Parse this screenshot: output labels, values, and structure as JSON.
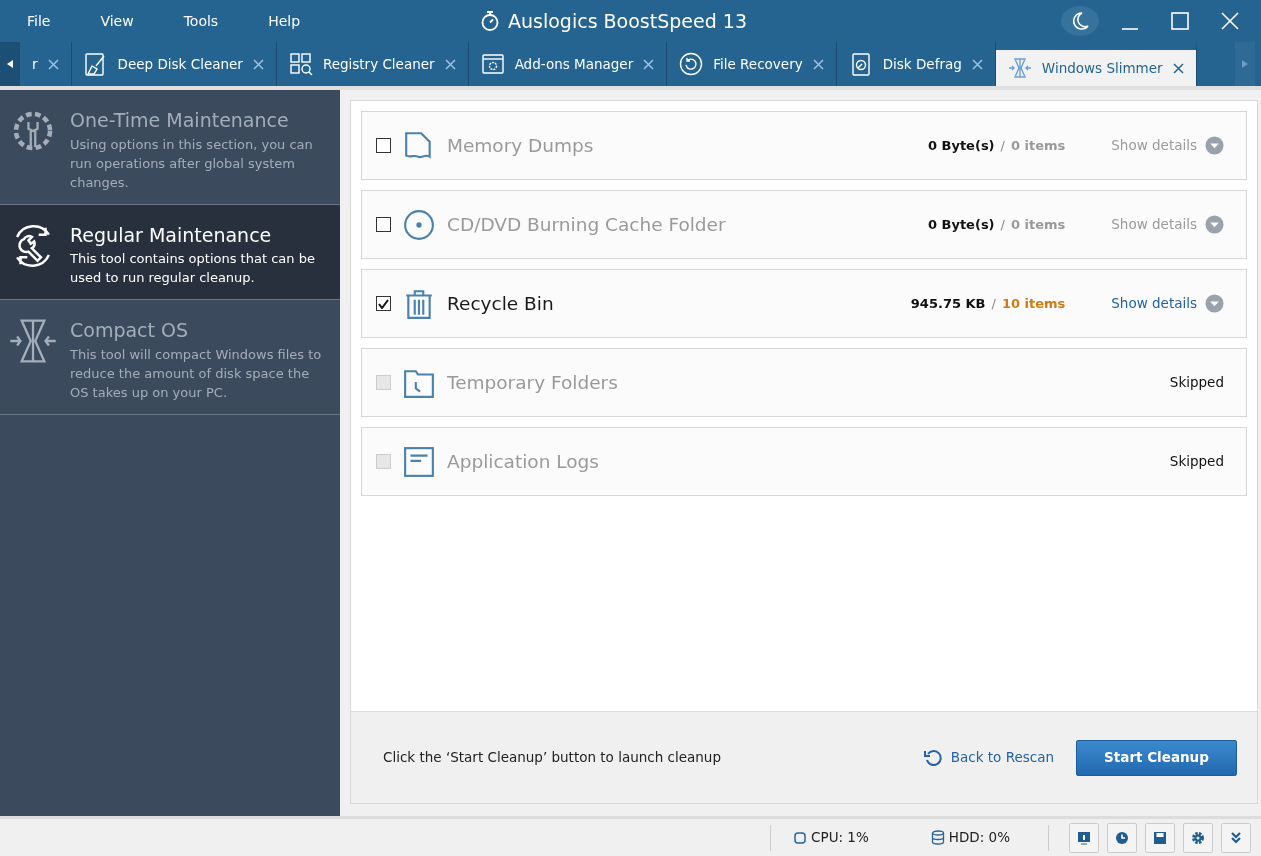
{
  "menu": [
    "File",
    "View",
    "Tools",
    "Help"
  ],
  "window": {
    "title": "Auslogics BoostSpeed 13"
  },
  "tabs": [
    {
      "label": "r",
      "selected": false
    },
    {
      "label": "Deep Disk Cleaner",
      "selected": false
    },
    {
      "label": "Registry Cleaner",
      "selected": false
    },
    {
      "label": "Add-ons Manager",
      "selected": false
    },
    {
      "label": "File Recovery",
      "selected": false
    },
    {
      "label": "Disk Defrag",
      "selected": false
    },
    {
      "label": "Windows Slimmer",
      "selected": true
    }
  ],
  "sidebar": {
    "items": [
      {
        "title": "One-Time Maintenance",
        "description": "Using options in this section, you can run operations after global system changes.",
        "selected": false
      },
      {
        "title": "Regular Maintenance",
        "description": "This tool contains options that can be used to run regular cleanup.",
        "selected": true
      },
      {
        "title": "Compact OS",
        "description": "This tool will compact Windows files to reduce the amount of disk space the OS takes up on your PC.",
        "selected": false
      }
    ]
  },
  "items": [
    {
      "name": "Memory Dumps",
      "kind": "scanned",
      "checked": false,
      "disabled": false,
      "size": "0 Byte(s)",
      "separator": "/",
      "count": "0 items",
      "details": "Show details"
    },
    {
      "name": "CD/DVD Burning Cache Folder",
      "kind": "scanned",
      "checked": false,
      "disabled": false,
      "size": "0 Byte(s)",
      "separator": "/",
      "count": "0 items",
      "details": "Show details"
    },
    {
      "name": "Recycle Bin",
      "kind": "scanned",
      "checked": true,
      "disabled": false,
      "size": "945.75 KB",
      "separator": "/",
      "count": "10 items",
      "details": "Show details"
    },
    {
      "name": "Temporary Folders",
      "kind": "skipped",
      "checked": false,
      "disabled": true,
      "status": "Skipped"
    },
    {
      "name": "Application Logs",
      "kind": "skipped",
      "checked": false,
      "disabled": true,
      "status": "Skipped"
    }
  ],
  "footer": {
    "hint": "Click the ‘Start Cleanup’ button to launch cleanup",
    "rescan": "Back to Rescan",
    "start": "Start Cleanup"
  },
  "status_bar": {
    "cpu": "CPU: 1%",
    "hdd": "HDD: 0%"
  }
}
